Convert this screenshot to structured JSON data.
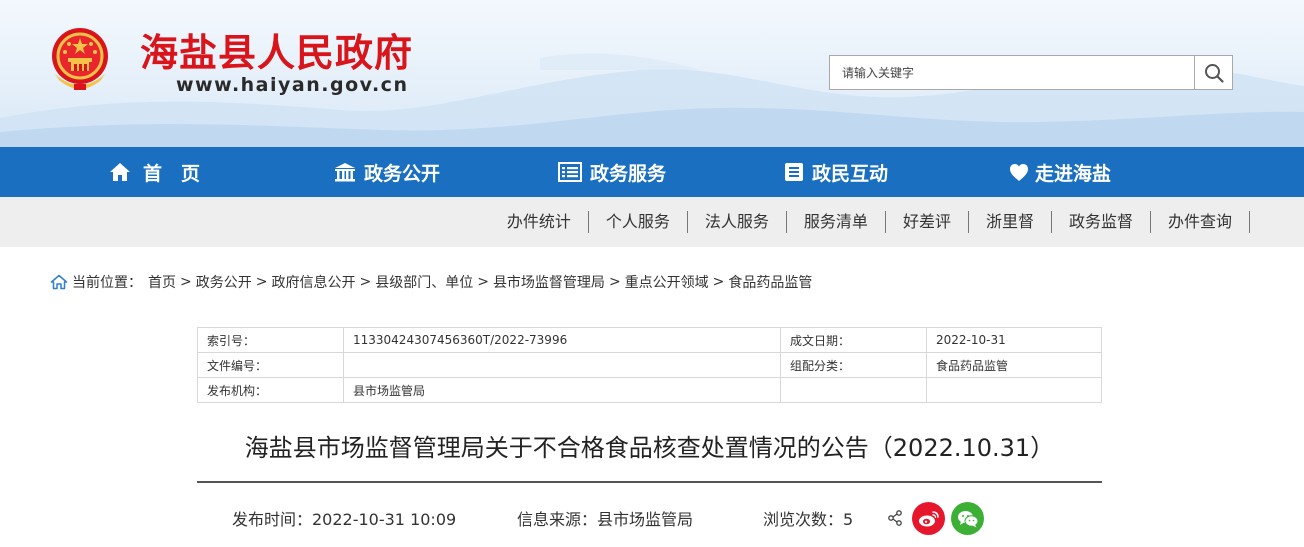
{
  "header": {
    "site_title": "海盐县人民政府",
    "site_url": "www.haiyan.gov.cn",
    "search_placeholder": "请输入关键字"
  },
  "main_nav": [
    {
      "label": "首　页",
      "icon": "home-icon"
    },
    {
      "label": "政务公开",
      "icon": "building-icon"
    },
    {
      "label": "政务服务",
      "icon": "list-icon"
    },
    {
      "label": "政民互动",
      "icon": "document-icon"
    },
    {
      "label": "走进海盐",
      "icon": "heart-icon"
    }
  ],
  "sub_nav": [
    "办件统计",
    "个人服务",
    "法人服务",
    "服务清单",
    "好差评",
    "浙里督",
    "政务监督",
    "办件查询"
  ],
  "breadcrumb": {
    "prefix": "当前位置：",
    "items": [
      "首页",
      "政务公开",
      "政府信息公开",
      "县级部门、单位",
      "县市场监督管理局",
      "重点公开领域",
      "食品药品监管"
    ]
  },
  "info_table": {
    "rows": [
      {
        "label1": "索引号：",
        "value1": "11330424307456360T/2022-73996",
        "label2": "成文日期：",
        "value2": "2022-10-31"
      },
      {
        "label1": "文件编号：",
        "value1": "",
        "label2": "组配分类：",
        "value2": "食品药品监管"
      },
      {
        "label1": "发布机构：",
        "value1": "县市场监管局",
        "label2": "",
        "value2": ""
      }
    ]
  },
  "article": {
    "title": "海盐县市场监督管理局关于不合格食品核查处置情况的公告（2022.10.31）",
    "publish_time": "发布时间：2022-10-31 10:09",
    "source": "信息来源：县市场监管局",
    "views": "浏览次数：5"
  },
  "colors": {
    "brand_red": "#d9141b",
    "nav_blue": "#1a6fc0",
    "subnav_gray": "#eeeeee",
    "weibo_red": "#e6162d",
    "wechat_green": "#3cb034"
  }
}
